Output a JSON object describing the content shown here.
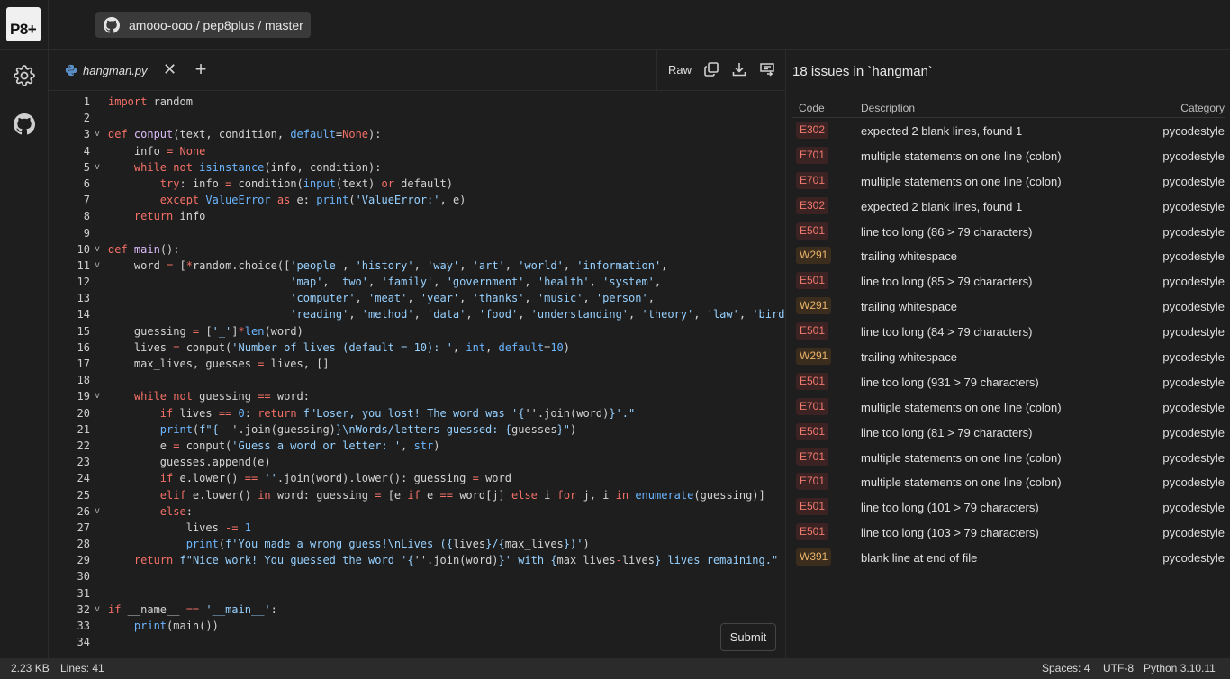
{
  "app": {
    "logo_text": "P8+"
  },
  "repo": {
    "path": "amooo-ooo / pep8plus / master"
  },
  "rail": {
    "icons": [
      "gear-icon",
      "github-icon"
    ]
  },
  "editor": {
    "tab_label": "hangman.py",
    "tab_close": "✕",
    "add_tab": "+",
    "raw_label": "Raw",
    "submit_label": "Submit",
    "lines": [
      [
        {
          "t": "import",
          "c": "kw"
        },
        {
          "t": " random"
        }
      ],
      [],
      [
        {
          "t": "def ",
          "c": "kw"
        },
        {
          "t": "conput",
          "c": "fn"
        },
        {
          "t": "(text, condition, "
        },
        {
          "t": "default",
          "c": "bi"
        },
        {
          "t": "="
        },
        {
          "t": "None",
          "c": "kw"
        },
        {
          "t": "):"
        }
      ],
      [
        {
          "t": "    info "
        },
        {
          "t": "=",
          "c": "kw"
        },
        {
          "t": " "
        },
        {
          "t": "None",
          "c": "kw"
        }
      ],
      [
        {
          "t": "    "
        },
        {
          "t": "while not ",
          "c": "kw"
        },
        {
          "t": "isinstance",
          "c": "bi"
        },
        {
          "t": "(info, condition):"
        }
      ],
      [
        {
          "t": "        "
        },
        {
          "t": "try",
          "c": "kw"
        },
        {
          "t": ": info "
        },
        {
          "t": "=",
          "c": "kw"
        },
        {
          "t": " condition("
        },
        {
          "t": "input",
          "c": "bi"
        },
        {
          "t": "(text) "
        },
        {
          "t": "or",
          "c": "kw"
        },
        {
          "t": " default)"
        }
      ],
      [
        {
          "t": "        "
        },
        {
          "t": "except ",
          "c": "kw"
        },
        {
          "t": "ValueError",
          "c": "bi"
        },
        {
          "t": " as ",
          "c": "kw"
        },
        {
          "t": "e: "
        },
        {
          "t": "print",
          "c": "bi"
        },
        {
          "t": "("
        },
        {
          "t": "'ValueError:'",
          "c": "st"
        },
        {
          "t": ", e)"
        }
      ],
      [
        {
          "t": "    "
        },
        {
          "t": "return",
          "c": "kw"
        },
        {
          "t": " info"
        }
      ],
      [],
      [
        {
          "t": "def ",
          "c": "kw"
        },
        {
          "t": "main",
          "c": "fn"
        },
        {
          "t": "():"
        }
      ],
      [
        {
          "t": "    word "
        },
        {
          "t": "=",
          "c": "kw"
        },
        {
          "t": " ["
        },
        {
          "t": "*",
          "c": "kw"
        },
        {
          "t": "random.choice(["
        },
        {
          "t": "'people'",
          "c": "st"
        },
        {
          "t": ", "
        },
        {
          "t": "'history'",
          "c": "st"
        },
        {
          "t": ", "
        },
        {
          "t": "'way'",
          "c": "st"
        },
        {
          "t": ", "
        },
        {
          "t": "'art'",
          "c": "st"
        },
        {
          "t": ", "
        },
        {
          "t": "'world'",
          "c": "st"
        },
        {
          "t": ", "
        },
        {
          "t": "'information'",
          "c": "st"
        },
        {
          "t": ","
        }
      ],
      [
        {
          "t": "                            "
        },
        {
          "t": "'map'",
          "c": "st"
        },
        {
          "t": ", "
        },
        {
          "t": "'two'",
          "c": "st"
        },
        {
          "t": ", "
        },
        {
          "t": "'family'",
          "c": "st"
        },
        {
          "t": ", "
        },
        {
          "t": "'government'",
          "c": "st"
        },
        {
          "t": ", "
        },
        {
          "t": "'health'",
          "c": "st"
        },
        {
          "t": ", "
        },
        {
          "t": "'system'",
          "c": "st"
        },
        {
          "t": ","
        }
      ],
      [
        {
          "t": "                            "
        },
        {
          "t": "'computer'",
          "c": "st"
        },
        {
          "t": ", "
        },
        {
          "t": "'meat'",
          "c": "st"
        },
        {
          "t": ", "
        },
        {
          "t": "'year'",
          "c": "st"
        },
        {
          "t": ", "
        },
        {
          "t": "'thanks'",
          "c": "st"
        },
        {
          "t": ", "
        },
        {
          "t": "'music'",
          "c": "st"
        },
        {
          "t": ", "
        },
        {
          "t": "'person'",
          "c": "st"
        },
        {
          "t": ","
        }
      ],
      [
        {
          "t": "                            "
        },
        {
          "t": "'reading'",
          "c": "st"
        },
        {
          "t": ", "
        },
        {
          "t": "'method'",
          "c": "st"
        },
        {
          "t": ", "
        },
        {
          "t": "'data'",
          "c": "st"
        },
        {
          "t": ", "
        },
        {
          "t": "'food'",
          "c": "st"
        },
        {
          "t": ", "
        },
        {
          "t": "'understanding'",
          "c": "st"
        },
        {
          "t": ", "
        },
        {
          "t": "'theory'",
          "c": "st"
        },
        {
          "t": ", "
        },
        {
          "t": "'law'",
          "c": "st"
        },
        {
          "t": ", "
        },
        {
          "t": "'bird'",
          "c": "st"
        },
        {
          "t": ","
        }
      ],
      [
        {
          "t": "    guessing "
        },
        {
          "t": "=",
          "c": "kw"
        },
        {
          "t": " ["
        },
        {
          "t": "'_'",
          "c": "st"
        },
        {
          "t": "]"
        },
        {
          "t": "*",
          "c": "kw"
        },
        {
          "t": "len",
          "c": "bi"
        },
        {
          "t": "(word)"
        }
      ],
      [
        {
          "t": "    lives "
        },
        {
          "t": "=",
          "c": "kw"
        },
        {
          "t": " conput("
        },
        {
          "t": "'Number of lives (default = 10): '",
          "c": "st"
        },
        {
          "t": ", "
        },
        {
          "t": "int",
          "c": "bi"
        },
        {
          "t": ", "
        },
        {
          "t": "default",
          "c": "bi"
        },
        {
          "t": "="
        },
        {
          "t": "10",
          "c": "nm"
        },
        {
          "t": ")"
        }
      ],
      [
        {
          "t": "    max_lives, guesses "
        },
        {
          "t": "=",
          "c": "kw"
        },
        {
          "t": " lives, []"
        }
      ],
      [],
      [
        {
          "t": "    "
        },
        {
          "t": "while not ",
          "c": "kw"
        },
        {
          "t": "guessing "
        },
        {
          "t": "==",
          "c": "kw"
        },
        {
          "t": " word:"
        }
      ],
      [
        {
          "t": "        "
        },
        {
          "t": "if",
          "c": "kw"
        },
        {
          "t": " lives "
        },
        {
          "t": "==",
          "c": "kw"
        },
        {
          "t": " "
        },
        {
          "t": "0",
          "c": "nm"
        },
        {
          "t": ": "
        },
        {
          "t": "return",
          "c": "kw"
        },
        {
          "t": " "
        },
        {
          "t": "f\"Loser, you lost! The word was '{",
          "c": "st"
        },
        {
          "t": "''.join(word)"
        },
        {
          "t": "}'.\"",
          "c": "st"
        }
      ],
      [
        {
          "t": "        "
        },
        {
          "t": "print",
          "c": "bi"
        },
        {
          "t": "("
        },
        {
          "t": "f\"{",
          "c": "st"
        },
        {
          "t": "' '.join(guessing)"
        },
        {
          "t": "}\\nWords/letters guessed: {",
          "c": "st"
        },
        {
          "t": "guesses"
        },
        {
          "t": "}\"",
          "c": "st"
        },
        {
          "t": ")"
        }
      ],
      [
        {
          "t": "        e "
        },
        {
          "t": "=",
          "c": "kw"
        },
        {
          "t": " conput("
        },
        {
          "t": "'Guess a word or letter: '",
          "c": "st"
        },
        {
          "t": ", "
        },
        {
          "t": "str",
          "c": "bi"
        },
        {
          "t": ")"
        }
      ],
      [
        {
          "t": "        guesses.append(e)"
        }
      ],
      [
        {
          "t": "        "
        },
        {
          "t": "if",
          "c": "kw"
        },
        {
          "t": " e.lower() "
        },
        {
          "t": "==",
          "c": "kw"
        },
        {
          "t": " "
        },
        {
          "t": "''",
          "c": "st"
        },
        {
          "t": ".join(word).lower(): guessing "
        },
        {
          "t": "=",
          "c": "kw"
        },
        {
          "t": " word"
        }
      ],
      [
        {
          "t": "        "
        },
        {
          "t": "elif",
          "c": "kw"
        },
        {
          "t": " e.lower() "
        },
        {
          "t": "in",
          "c": "kw"
        },
        {
          "t": " word: guessing "
        },
        {
          "t": "=",
          "c": "kw"
        },
        {
          "t": " [e "
        },
        {
          "t": "if",
          "c": "kw"
        },
        {
          "t": " e "
        },
        {
          "t": "==",
          "c": "kw"
        },
        {
          "t": " word[j] "
        },
        {
          "t": "else",
          "c": "kw"
        },
        {
          "t": " i "
        },
        {
          "t": "for",
          "c": "kw"
        },
        {
          "t": " j, i "
        },
        {
          "t": "in",
          "c": "kw"
        },
        {
          "t": " "
        },
        {
          "t": "enumerate",
          "c": "bi"
        },
        {
          "t": "(guessing)]"
        }
      ],
      [
        {
          "t": "        "
        },
        {
          "t": "else",
          "c": "kw"
        },
        {
          "t": ":"
        }
      ],
      [
        {
          "t": "            lives "
        },
        {
          "t": "-=",
          "c": "kw"
        },
        {
          "t": " "
        },
        {
          "t": "1",
          "c": "nm"
        }
      ],
      [
        {
          "t": "            "
        },
        {
          "t": "print",
          "c": "bi"
        },
        {
          "t": "("
        },
        {
          "t": "f'You made a wrong guess!\\nLives ({",
          "c": "st"
        },
        {
          "t": "lives"
        },
        {
          "t": "}/{",
          "c": "st"
        },
        {
          "t": "max_lives"
        },
        {
          "t": "})'",
          "c": "st"
        },
        {
          "t": ")"
        }
      ],
      [
        {
          "t": "    "
        },
        {
          "t": "return",
          "c": "kw"
        },
        {
          "t": " "
        },
        {
          "t": "f\"Nice work! You guessed the word '{",
          "c": "st"
        },
        {
          "t": "''.join(word)"
        },
        {
          "t": "}' with {",
          "c": "st"
        },
        {
          "t": "max_lives"
        },
        {
          "t": "-",
          "c": "kw"
        },
        {
          "t": "lives"
        },
        {
          "t": "} lives remaining.\"",
          "c": "st"
        }
      ],
      [],
      [],
      [
        {
          "t": "if",
          "c": "kw"
        },
        {
          "t": " __name__ "
        },
        {
          "t": "==",
          "c": "kw"
        },
        {
          "t": " "
        },
        {
          "t": "'__main__'",
          "c": "st"
        },
        {
          "t": ":"
        }
      ],
      [
        {
          "t": "    "
        },
        {
          "t": "print",
          "c": "bi"
        },
        {
          "t": "(main())"
        }
      ],
      []
    ],
    "fold_lines": [
      3,
      5,
      10,
      11,
      19,
      26,
      32
    ],
    "fold_glyph": "v"
  },
  "issues": {
    "title": "18 issues in `hangman`",
    "headers": {
      "code": "Code",
      "description": "Description",
      "category": "Category"
    },
    "rows": [
      {
        "code": "E302",
        "desc": "expected 2 blank lines, found 1",
        "cat": "pycodestyle"
      },
      {
        "code": "E701",
        "desc": "multiple statements on one line (colon)",
        "cat": "pycodestyle"
      },
      {
        "code": "E701",
        "desc": "multiple statements on one line (colon)",
        "cat": "pycodestyle"
      },
      {
        "code": "E302",
        "desc": "expected 2 blank lines, found 1",
        "cat": "pycodestyle"
      },
      {
        "code": "E501",
        "desc": "line too long (86 > 79 characters)",
        "cat": "pycodestyle"
      },
      {
        "code": "W291",
        "desc": "trailing whitespace",
        "cat": "pycodestyle"
      },
      {
        "code": "E501",
        "desc": "line too long (85 > 79 characters)",
        "cat": "pycodestyle"
      },
      {
        "code": "W291",
        "desc": "trailing whitespace",
        "cat": "pycodestyle"
      },
      {
        "code": "E501",
        "desc": "line too long (84 > 79 characters)",
        "cat": "pycodestyle"
      },
      {
        "code": "W291",
        "desc": "trailing whitespace",
        "cat": "pycodestyle"
      },
      {
        "code": "E501",
        "desc": "line too long (931 > 79 characters)",
        "cat": "pycodestyle"
      },
      {
        "code": "E701",
        "desc": "multiple statements on one line (colon)",
        "cat": "pycodestyle"
      },
      {
        "code": "E501",
        "desc": "line too long (81 > 79 characters)",
        "cat": "pycodestyle"
      },
      {
        "code": "E701",
        "desc": "multiple statements on one line (colon)",
        "cat": "pycodestyle"
      },
      {
        "code": "E701",
        "desc": "multiple statements on one line (colon)",
        "cat": "pycodestyle"
      },
      {
        "code": "E501",
        "desc": "line too long (101 > 79 characters)",
        "cat": "pycodestyle"
      },
      {
        "code": "E501",
        "desc": "line too long (103 > 79 characters)",
        "cat": "pycodestyle"
      },
      {
        "code": "W391",
        "desc": "blank line at end of file",
        "cat": "pycodestyle"
      }
    ]
  },
  "status": {
    "size": "2.23 KB",
    "lines": "Lines: 41",
    "spaces": "Spaces: 4",
    "encoding": "UTF-8",
    "language": "Python 3.10.11"
  },
  "colors": {
    "error_badge": "#f07a6e",
    "warning_badge": "#eab46a",
    "background": "#1e1e1e"
  }
}
